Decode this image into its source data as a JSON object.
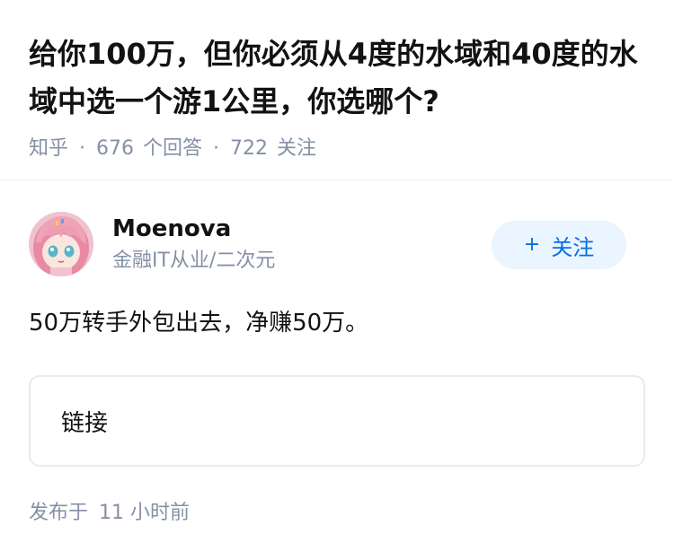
{
  "question": {
    "title": "给你100万，但你必须从4度的水域和40度的水域中选一个游1公里，你选哪个?",
    "source": "知乎",
    "answer_count": "676",
    "answer_label": "个回答",
    "follower_count": "722",
    "follower_label": "关注"
  },
  "author": {
    "name": "Moenova",
    "headline": "金融IT从业/二次元",
    "follow_label": "关注",
    "avatar_icon": "avatar-pink-hair-anime-girl"
  },
  "answer": {
    "text": "50万转手外包出去，净赚50万。",
    "link_label": "链接",
    "published_label": "发布于",
    "published_time": "11 小时前"
  },
  "colors": {
    "accent": "#056de8",
    "accent_bg": "#ebf5ff",
    "meta": "#8590a6",
    "text": "#121212"
  }
}
